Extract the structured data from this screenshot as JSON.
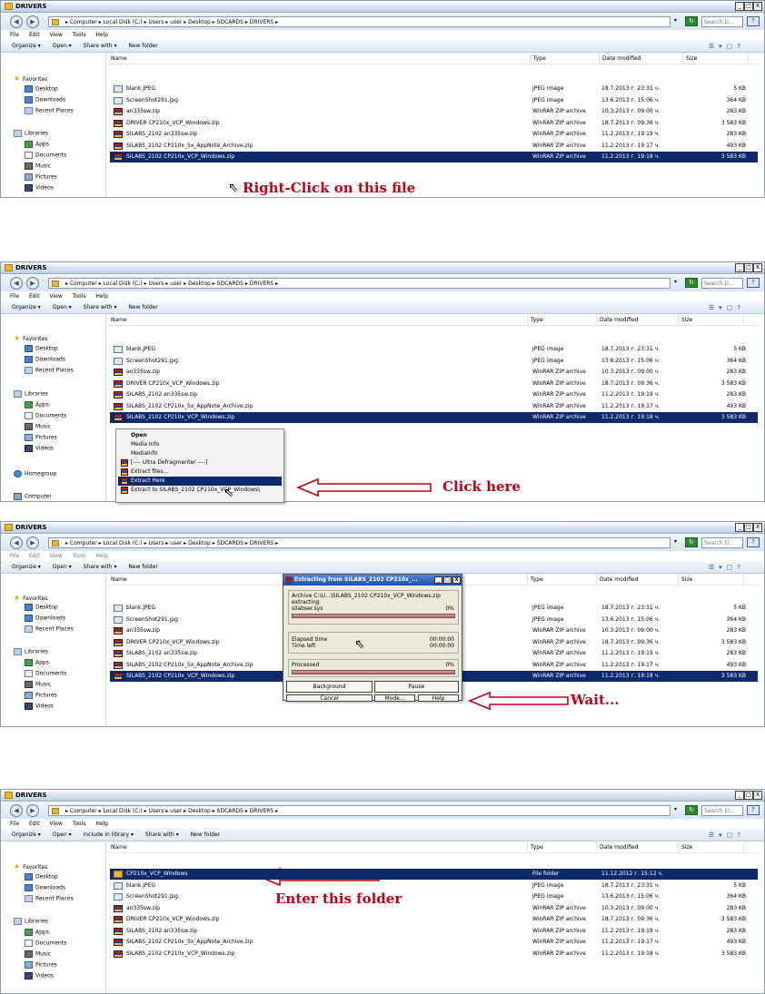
{
  "window": {
    "title": "DRIVERS",
    "controls": [
      "_",
      "□",
      "X"
    ]
  },
  "address": {
    "crumbs": "▸ Computer ▸ Local Disk (C:) ▸ Users ▸ user ▸ Desktop ▸ SDCARDS ▸ DRIVERS ▸",
    "search_placeholder": "Search D...",
    "nav_back": "◀",
    "nav_forward": "▶"
  },
  "menu": [
    "File",
    "Edit",
    "View",
    "Tools",
    "Help"
  ],
  "toolbar": {
    "organize": "Organize ▾",
    "open": "Open ▾",
    "share": "Share with ▾",
    "new_folder": "New folder",
    "include_library": "Include in library ▾"
  },
  "columns": {
    "name": "Name",
    "type": "Type",
    "date": "Date modified",
    "size": "Size"
  },
  "nav": {
    "favorites": "Favorites",
    "desktop": "Desktop",
    "downloads": "Downloads",
    "recent": "Recent Places",
    "libraries": "Libraries",
    "apps": "Apps",
    "documents": "Documents",
    "music": "Music",
    "pictures": "Pictures",
    "videos": "Videos",
    "homegroup": "Homegroup",
    "computer": "Computer"
  },
  "files": [
    {
      "name": "blank.JPEG",
      "type": "JPEG image",
      "date": "18.7.2013 г. 23:31 ч.",
      "size": "5 KB",
      "kind": "img"
    },
    {
      "name": "ScreenShot291.jpg",
      "type": "JPEG image",
      "date": "13.6.2013 г. 15:06 ч.",
      "size": "364 KB",
      "kind": "img"
    },
    {
      "name": "an335sw.zip",
      "type": "WinRAR ZIP archive",
      "date": "10.3.2013 г. 09:00 ч.",
      "size": "283 KB",
      "kind": "zip"
    },
    {
      "name": "DRIVER CP210x_VCP_Windows.zip",
      "type": "WinRAR ZIP archive",
      "date": "18.7.2013 г. 09:36 ч.",
      "size": "3 583 KB",
      "kind": "zip"
    },
    {
      "name": "SILABS_2102 an335sw.zip",
      "type": "WinRAR ZIP archive",
      "date": "11.2.2013 г. 19:19 ч.",
      "size": "283 KB",
      "kind": "zip"
    },
    {
      "name": "SILABS_2102 CP210x_5x_AppNote_Archive.zip",
      "type": "WinRAR ZIP archive",
      "date": "11.2.2013 г. 19:17 ч.",
      "size": "493 KB",
      "kind": "zip"
    },
    {
      "name": "SILABS_2102 CP210x_VCP_Windows.zip",
      "type": "WinRAR ZIP archive",
      "date": "11.2.2013 г. 19:18 ч.",
      "size": "3 583 KB",
      "kind": "zip"
    }
  ],
  "folder_row": {
    "name": "CP210x_VCP_Windows",
    "type": "File folder",
    "date": "11.12.2012 г. 15:12 ч.",
    "size": "",
    "kind": "folder"
  },
  "context_menu": [
    "Open",
    "Media Info",
    "MediaInfo",
    "[---- Ultra Defragmenter ----]",
    "Extract files...",
    "Extract Here",
    "Extract to SILABS_2102 CP210x_VCP_Windows\\"
  ],
  "dialog": {
    "title": "Extracting from SILABS_2102 CP210x_...",
    "archive": "Archive C:\\U...\\SILABS_2102 CP210x_VCP_Windows.zip",
    "extracting": "extracting",
    "file": "silabser.sys",
    "file_pct": "0%",
    "elapsed_label": "Elapsed time",
    "elapsed": "00:00:00",
    "left_label": "Time left",
    "left": "00:00:00",
    "processed_label": "Processed",
    "processed_pct": "0%",
    "buttons": [
      "Background",
      "Pause",
      "Cancel",
      "Mode...",
      "Help"
    ]
  },
  "annotations": {
    "a1": "Right-Click on this file",
    "a2": "Click here",
    "a3": "Wait...",
    "a4": "Enter this folder"
  },
  "colors": {
    "selection": "#0e2a6d",
    "annotation": "#c00018"
  }
}
